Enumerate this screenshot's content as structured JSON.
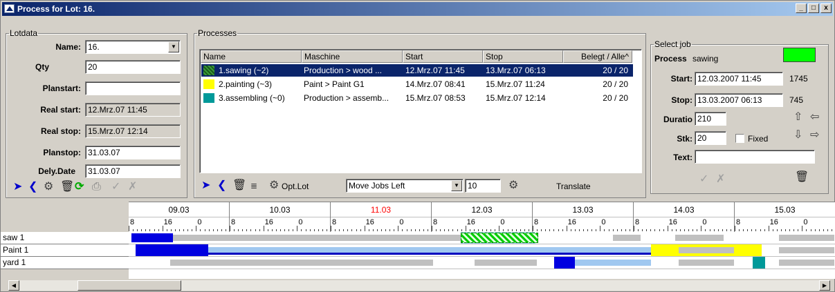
{
  "window": {
    "title": "Process for Lot: 16.",
    "btn_min": "_",
    "btn_max": "□",
    "btn_close": "x"
  },
  "lotdata": {
    "legend": "Lotdata",
    "name_label": "Name:",
    "name_value": "16.",
    "qty_label": "Qty",
    "qty_value": "20",
    "planstart_label": "Planstart:",
    "planstart_value": "",
    "realstart_label": "Real start:",
    "realstart_value": "12.Mrz.07 11:45",
    "realstop_label": "Real stop:",
    "realstop_value": "15.Mrz.07 12:14",
    "planstop_label": "Planstop:",
    "planstop_value": "31.03.07",
    "dely_label": "Dely.Date",
    "dely_value": "31.03.07"
  },
  "processes": {
    "legend": "Processes",
    "columns": [
      "Name",
      "Maschine",
      "Start",
      "Stop",
      "Belegt / Alle^"
    ],
    "rows": [
      {
        "name": "1.sawing (~2)",
        "maschine": "Production > wood ...",
        "start": "12.Mrz.07 11:45",
        "stop": "13.Mrz.07 06:13",
        "belegt": "20 / 20",
        "color": "#2e8b2e"
      },
      {
        "name": "2.painting (~3)",
        "maschine": "Paint > Paint G1",
        "start": "14.Mrz.07 08:41",
        "stop": "15.Mrz.07 11:24",
        "belegt": "20 / 20",
        "color": "#ffff00"
      },
      {
        "name": "3.assembling (~0)",
        "maschine": "Production > assemb...",
        "start": "15.Mrz.07 08:53",
        "stop": "15.Mrz.07 12:14",
        "belegt": "20 / 20",
        "color": "#009999"
      }
    ],
    "optlot_label": "Opt.Lot",
    "move_value": "Move Jobs Left",
    "num_value": "10",
    "translate_label": "Translate"
  },
  "selectjob": {
    "legend": "Select job",
    "process_label": "Process",
    "process_value": "sawing",
    "process_color": "#00ff00",
    "start_label": "Start:",
    "start_value": "12.03.2007 11:45",
    "start_num": "1745",
    "stop_label": "Stop:",
    "stop_value": "13.03.2007 06:13",
    "stop_num": "745",
    "duratio_label": "Duratio",
    "duratio_value": "210",
    "stk_label": "Stk:",
    "stk_value": "20",
    "fixed_label": "Fixed",
    "text_label": "Text:",
    "text_value": ""
  },
  "gantt": {
    "days": [
      "09.03",
      "10.03",
      "11.03",
      "12.03",
      "13.03",
      "14.03",
      "15.03"
    ],
    "highlight_day": "11.03",
    "ticks": [
      "8",
      "16",
      "0",
      "8",
      "16",
      "0",
      "8",
      "16",
      "0",
      "8",
      "16",
      "0",
      "8",
      "16",
      "0",
      "8",
      "16",
      "0",
      "8",
      "16",
      "0"
    ],
    "resources": [
      "saw 1",
      "Paint 1",
      "yard 1"
    ]
  }
}
